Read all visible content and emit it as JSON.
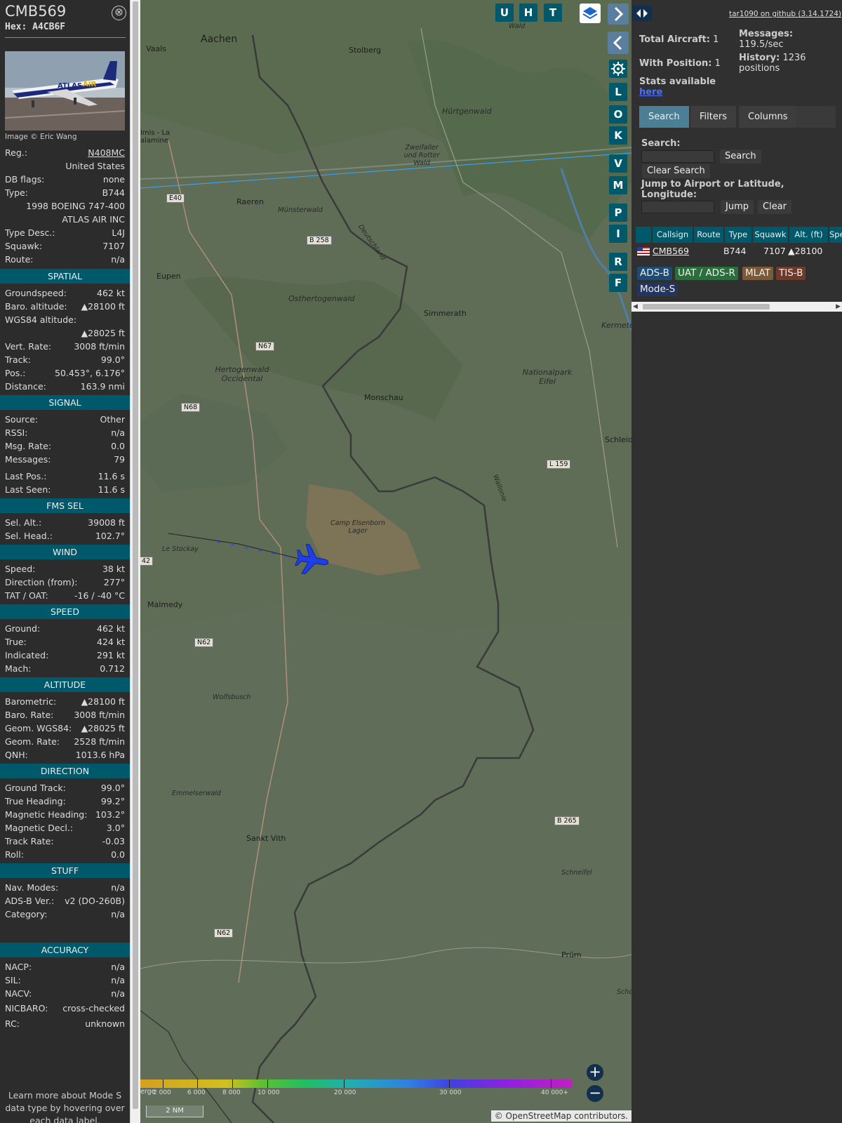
{
  "sidebar": {
    "callsign": "CMB569",
    "hex_label": "Hex:",
    "hex": "A4CB6F",
    "close_symbol": "⊗",
    "photo_credit": "Image © Eric Wang",
    "top_rows": [
      {
        "label": "Reg.:",
        "value": "N408MC"
      },
      {
        "label": "",
        "value": "United States"
      },
      {
        "label": "DB flags:",
        "value": "none"
      },
      {
        "label": "Type:",
        "value": "B744"
      },
      {
        "label": "",
        "value": "1998 BOEING 747-400"
      },
      {
        "label": "",
        "value": "ATLAS AIR INC"
      },
      {
        "label": "Type Desc.:",
        "value": "L4J"
      },
      {
        "label": "Squawk:",
        "value": "7107"
      },
      {
        "label": "Route:",
        "value": "n/a"
      }
    ],
    "sections": [
      {
        "title": "SPATIAL",
        "rows": [
          {
            "label": "Groundspeed:",
            "value": "462 kt"
          },
          {
            "label": "Baro. altitude:",
            "value": "▲28100 ft"
          },
          {
            "label": "WGS84 altitude:",
            "value": ""
          },
          {
            "label": "",
            "value": "▲28025 ft"
          },
          {
            "label": "Vert. Rate:",
            "value": "3008 ft/min"
          },
          {
            "label": "Track:",
            "value": "99.0°"
          },
          {
            "label": "Pos.:",
            "value": "50.453°, 6.176°"
          },
          {
            "label": "Distance:",
            "value": "163.9 nmi"
          }
        ]
      },
      {
        "title": "SIGNAL",
        "rows": [
          {
            "label": "Source:",
            "value": "Other"
          },
          {
            "label": "RSSI:",
            "value": "n/a"
          },
          {
            "label": "Msg. Rate:",
            "value": "0.0"
          },
          {
            "label": "Messages:",
            "value": "79"
          },
          {
            "label": "Last Pos.:",
            "value": "11.6 s"
          },
          {
            "label": "Last Seen:",
            "value": "11.6 s"
          }
        ]
      },
      {
        "title": "FMS SEL",
        "rows": [
          {
            "label": "Sel. Alt.:",
            "value": "39008 ft"
          },
          {
            "label": "Sel. Head.:",
            "value": "102.7°"
          }
        ]
      },
      {
        "title": "WIND",
        "rows": [
          {
            "label": "Speed:",
            "value": "38 kt"
          },
          {
            "label": "Direction (from):",
            "value": "277°"
          },
          {
            "label": "TAT / OAT:",
            "value": "-16 / -40 °C"
          }
        ]
      },
      {
        "title": "SPEED",
        "rows": [
          {
            "label": "Ground:",
            "value": "462 kt"
          },
          {
            "label": "True:",
            "value": "424 kt"
          },
          {
            "label": "Indicated:",
            "value": "291 kt"
          },
          {
            "label": "Mach:",
            "value": "0.712"
          }
        ]
      },
      {
        "title": "ALTITUDE",
        "rows": [
          {
            "label": "Barometric:",
            "value": "▲28100 ft"
          },
          {
            "label": "Baro. Rate:",
            "value": "3008 ft/min"
          },
          {
            "label": "Geom. WGS84:",
            "value": "▲28025 ft"
          },
          {
            "label": "Geom. Rate:",
            "value": "2528 ft/min"
          },
          {
            "label": "QNH:",
            "value": "1013.6 hPa"
          }
        ]
      },
      {
        "title": "DIRECTION",
        "rows": [
          {
            "label": "Ground Track:",
            "value": "99.0°"
          },
          {
            "label": "True Heading:",
            "value": "99.2°"
          },
          {
            "label": "Magnetic Heading:",
            "value": "103.2°"
          },
          {
            "label": "Magnetic Decl.:",
            "value": "3.0°"
          },
          {
            "label": "Track Rate:",
            "value": "-0.03"
          },
          {
            "label": "Roll:",
            "value": "0.0"
          }
        ]
      },
      {
        "title": "STUFF",
        "rows": [
          {
            "label": "Nav. Modes:",
            "value": "n/a"
          },
          {
            "label": "ADS-B Ver.:",
            "value": "v2 (DO-260B)"
          },
          {
            "label": "Category:",
            "value": "n/a"
          }
        ]
      },
      {
        "title": "ACCURACY",
        "rows": [
          {
            "label": "NACP:",
            "value": "n/a"
          },
          {
            "label": "SIL:",
            "value": "n/a"
          },
          {
            "label": "NACV:",
            "value": "n/a"
          },
          {
            "label": "NICBARO:",
            "value": "cross-checked"
          },
          {
            "label": "RC:",
            "value": "unknown"
          }
        ]
      }
    ],
    "learn_more": "Learn more about Mode S data type by hovering over each data label."
  },
  "map": {
    "layer_buttons": [
      "U",
      "H",
      "T"
    ],
    "side_buttons": [
      "L",
      "O",
      "K",
      "V",
      "M",
      "P",
      "I",
      "R",
      "F"
    ],
    "attribution": "© OpenStreetMap contributors.",
    "scale": "2 NM",
    "altitude_ticks": [
      "2 000",
      "6 000",
      "8 000",
      "10 000",
      "20 000",
      "30 000",
      "40 000+"
    ],
    "altitude_partial": "erge",
    "places": [
      {
        "name": "Aachen"
      },
      {
        "name": "Vaals"
      },
      {
        "name": "Stolberg"
      },
      {
        "name": "Hürtgenwald"
      },
      {
        "name": "Zweifaller und Rotter Wald"
      },
      {
        "name": "lmis - La alamine"
      },
      {
        "name": "Raeren"
      },
      {
        "name": "Münsterwald"
      },
      {
        "name": "Eupen"
      },
      {
        "name": "Osthertogenwald"
      },
      {
        "name": "Simmerath"
      },
      {
        "name": "Kermeter"
      },
      {
        "name": "Hertogenwald Occidental"
      },
      {
        "name": "Nationalpark Eifel"
      },
      {
        "name": "Monschau"
      },
      {
        "name": "Schleid"
      },
      {
        "name": "Camp Elsenborn Lager"
      },
      {
        "name": "Le Stockay"
      },
      {
        "name": "Malmedy"
      },
      {
        "name": "Wolfsbusch"
      },
      {
        "name": "Emmelserwald"
      },
      {
        "name": "Sankt Vith"
      },
      {
        "name": "Schneifel"
      },
      {
        "name": "Prüm"
      },
      {
        "name": "Wallonie"
      },
      {
        "name": "Deutschland"
      },
      {
        "name": "Wald"
      },
      {
        "name": "Scho"
      }
    ],
    "roads": [
      "E40",
      "B 258",
      "N67",
      "N68",
      "L 159",
      "42",
      "N62",
      "B 265",
      "N62"
    ]
  },
  "right": {
    "github_link": "tar1090 on github (3.14.1724)",
    "total_aircraft_label": "Total Aircraft:",
    "total_aircraft": "1",
    "with_position_label": "With Position:",
    "with_position": "1",
    "messages_label": "Messages:",
    "messages": "119.5/sec",
    "history_label": "History:",
    "history": "1236 positions",
    "stats_label": "Stats available",
    "stats_link": "here",
    "tabs": [
      "Search",
      "Filters",
      "Columns"
    ],
    "search_label": "Search:",
    "search_button": "Search",
    "clear_search_button": "Clear Search",
    "jump_label": "Jump to Airport or Latitude, Longitude:",
    "jump_button": "Jump",
    "clear_button": "Clear",
    "columns": [
      "",
      "Callsign",
      "Route",
      "Type",
      "Squawk",
      "Alt. (ft)",
      "Spe"
    ],
    "row": {
      "callsign": "CMB569",
      "route": "",
      "type": "B744",
      "squawk": "7107",
      "alt": "▲28100"
    },
    "legend": [
      {
        "label": "ADS-B",
        "color": "#1f4b72"
      },
      {
        "label": "UAT / ADS-R",
        "color": "#2a6f3b"
      },
      {
        "label": "MLAT",
        "color": "#7b5a3a"
      },
      {
        "label": "TIS-B",
        "color": "#6f3a2a"
      },
      {
        "label": "Mode-S",
        "color": "#23345f"
      }
    ]
  },
  "colors": {
    "accent": "#00596b",
    "aircraft": "#1e3fe8",
    "link": "#4b6fff"
  }
}
